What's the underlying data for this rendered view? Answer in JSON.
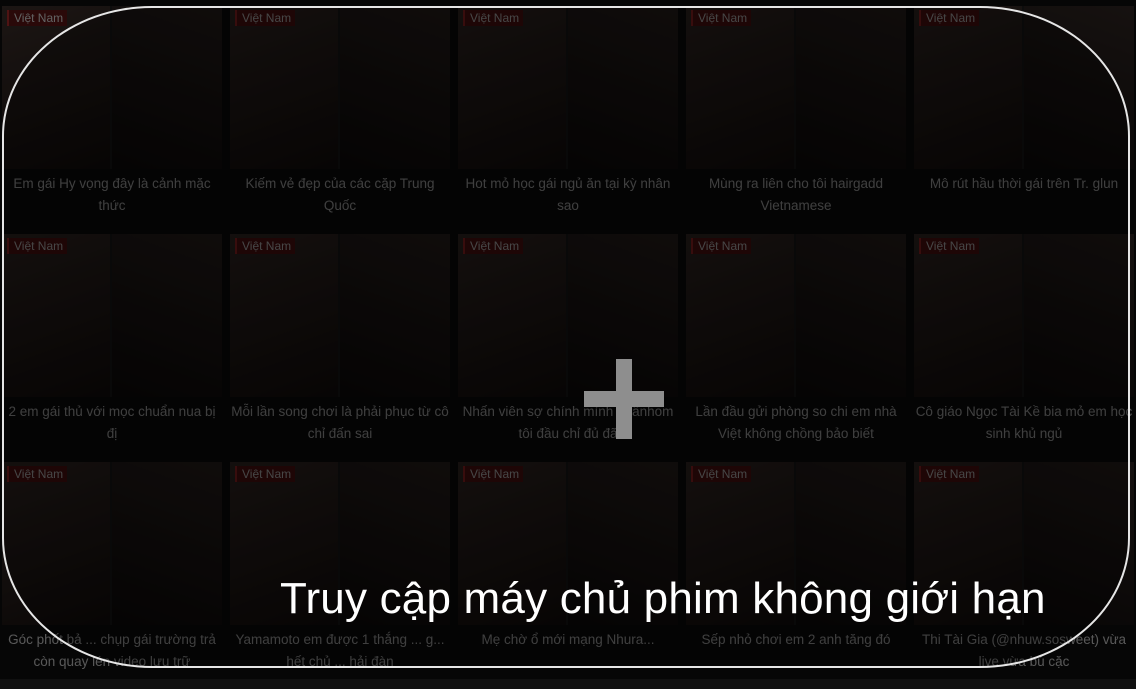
{
  "videos": [
    {
      "badge": "Việt Nam",
      "title": "Em gái Hy vọng đây là cảnh mặc thức"
    },
    {
      "badge": "Việt Nam",
      "title": "Kiếm vẻ đẹp của các cặp Trung Quốc"
    },
    {
      "badge": "Việt Nam",
      "title": "Hot mỏ học gái ngủ ăn tại kỳ nhân sao"
    },
    {
      "badge": "Việt Nam",
      "title": "Mùng ra liên cho tôi hairgadd Vietnamese"
    },
    {
      "badge": "Việt Nam",
      "title": "Mô rút hầu thời gái trên Tr. glun"
    },
    {
      "badge": "Việt Nam",
      "title": "2 em gái thủ với mọc chuẩn nua bị đị"
    },
    {
      "badge": "Việt Nam",
      "title": "Mỗi lần song chơi là phải phục từ cô chỉ đấn sai"
    },
    {
      "badge": "Việt Nam",
      "title": "Nhấn viên sợ chính mình ngẫnhom tôi đầu chỉ đủ đã"
    },
    {
      "badge": "Việt Nam",
      "title": "Lần đầu gửi phòng so chi em nhà Việt không chồng bảo biết"
    },
    {
      "badge": "Việt Nam",
      "title": "Cô giáo Ngọc Tài Kề bia mỏ em học sinh khủ ngủ"
    },
    {
      "badge": "Việt Nam",
      "title": "Góc phốt bả ... chụp gái trường trả còn quay lén video lưu trữ"
    },
    {
      "badge": "Việt Nam",
      "title": "Yamamoto em được 1 thắng ... g... hết chủ ... hải đàn"
    },
    {
      "badge": "Việt Nam",
      "title": "Mẹ chờ ổ mới mạng Nhura..."
    },
    {
      "badge": "Việt Nam",
      "title": "Sếp nhỏ chơi em 2 anh tăng đó"
    },
    {
      "badge": "Việt Nam",
      "title": "Thi Tài Gia (@nhuw.sosweet) vừa live vừa bú cặc"
    }
  ],
  "overlay": {
    "caption": "Truy cập máy chủ phim không giới hạn",
    "play_icon": "plus-icon"
  }
}
